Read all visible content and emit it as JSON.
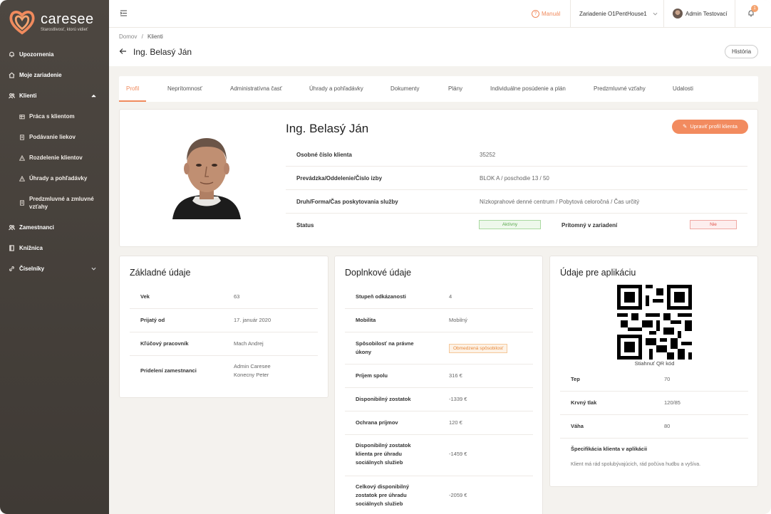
{
  "app": {
    "name": "caresee",
    "tagline": "Starostlivosť, ktorú vidieť",
    "accent": "#f08a5d"
  },
  "sidebar": {
    "items": [
      {
        "label": "Upozornenia",
        "icon": "bell-icon"
      },
      {
        "label": "Moje zariadenie",
        "icon": "home-icon"
      },
      {
        "label": "Klienti",
        "icon": "users-icon",
        "expanded": true
      },
      {
        "label": "Zamestnanci",
        "icon": "users-icon"
      },
      {
        "label": "Knižnica",
        "icon": "book-icon"
      },
      {
        "label": "Číselníky",
        "icon": "link-icon"
      }
    ],
    "sub_items": [
      {
        "label": "Práca s klientom",
        "icon": "table-icon"
      },
      {
        "label": "Podávanie liekov",
        "icon": "document-icon"
      },
      {
        "label": "Rozdelenie klientov",
        "icon": "warning-icon"
      },
      {
        "label": "Úhrady a pohľadávky",
        "icon": "warning-icon"
      },
      {
        "label": "Predzmluvné a zmluvné vzťahy",
        "icon": "document-icon"
      }
    ]
  },
  "topbar": {
    "manual": "Manuál",
    "device": "Zariadenie O1PentHouse1",
    "user": "Admin Testovací",
    "notifications": "1"
  },
  "breadcrumb": {
    "home": "Domov",
    "separator": "/",
    "current": "Klienti"
  },
  "page_title": "Ing. Belasý Ján",
  "history_button": "História",
  "tabs": [
    "Profil",
    "Neprítomnosť",
    "Administratívna časť",
    "Úhrady a pohľadávky",
    "Dokumenty",
    "Plány",
    "Individuálne posúdenie a plán",
    "Predzmluvné vzťahy",
    "Udalosti"
  ],
  "profile": {
    "name": "Ing. Belasý Ján",
    "edit_button": "Upraviť profil klienta",
    "rows": [
      {
        "label": "Osobné číslo klienta",
        "value": "35252"
      },
      {
        "label": "Prevádzka/Oddelenie/Číslo izby",
        "value": "BLOK A / poschodie 13 / 50"
      },
      {
        "label": "Druh/Forma/Čas poskytovania služby",
        "value": "Nízkoprahové denné centrum / Pobytová celoročná / Čas určitý"
      }
    ],
    "status_label": "Status",
    "status_value": "Aktívny",
    "present_label": "Prítomný v zariadení",
    "present_value": "Nie"
  },
  "basic": {
    "title": "Základné údaje",
    "rows": [
      {
        "label": "Vek",
        "value": "63"
      },
      {
        "label": "Prijatý od",
        "value": "17. január 2020"
      },
      {
        "label": "Kľúčový pracovník",
        "value": "Mach Andrej"
      },
      {
        "label": "Pridelení zamestnanci",
        "value": "Admin Caresee",
        "value2": "Konecny Peter"
      }
    ]
  },
  "extra": {
    "title": "Doplnkové údaje",
    "rows": [
      {
        "label": "Stupeň odkázanosti",
        "value": "4"
      },
      {
        "label": "Mobilita",
        "value": "Mobilný"
      },
      {
        "label": "Spôsobilosť na právne úkony",
        "label_l1": "Spôsobilosť na právne",
        "label_l2": "úkony",
        "value": "Obmedzená spôsobilosť"
      },
      {
        "label": "Príjem spolu",
        "value": "316 €"
      },
      {
        "label": "Disponibilný zostatok",
        "value": "-1339 €"
      },
      {
        "label": "Ochrana príjmov",
        "value": "120 €"
      },
      {
        "label_l1": "Disponibilný zostatok",
        "label_l2": "klienta pre úhradu",
        "label_l3": "sociálnych služieb",
        "value": "-1459 €"
      },
      {
        "label_l1": "Celkový disponibilný",
        "label_l2": "zostatok pre úhradu",
        "label_l3": "sociálnych služieb",
        "value": "-2059 €"
      }
    ]
  },
  "app_data": {
    "title": "Údaje pre aplikáciu",
    "qr_label": "Stiahnuť QR kód",
    "rows": [
      {
        "label": "Tep",
        "value": "70"
      },
      {
        "label": "Krvný tlak",
        "value": "120/85"
      },
      {
        "label": "Váha",
        "value": "80"
      }
    ],
    "spec_label": "Špecifikácia klienta v aplikácii",
    "spec_value": "Klient má rád spolubývajúcich, rád počúva hudbu a vyšíva."
  }
}
